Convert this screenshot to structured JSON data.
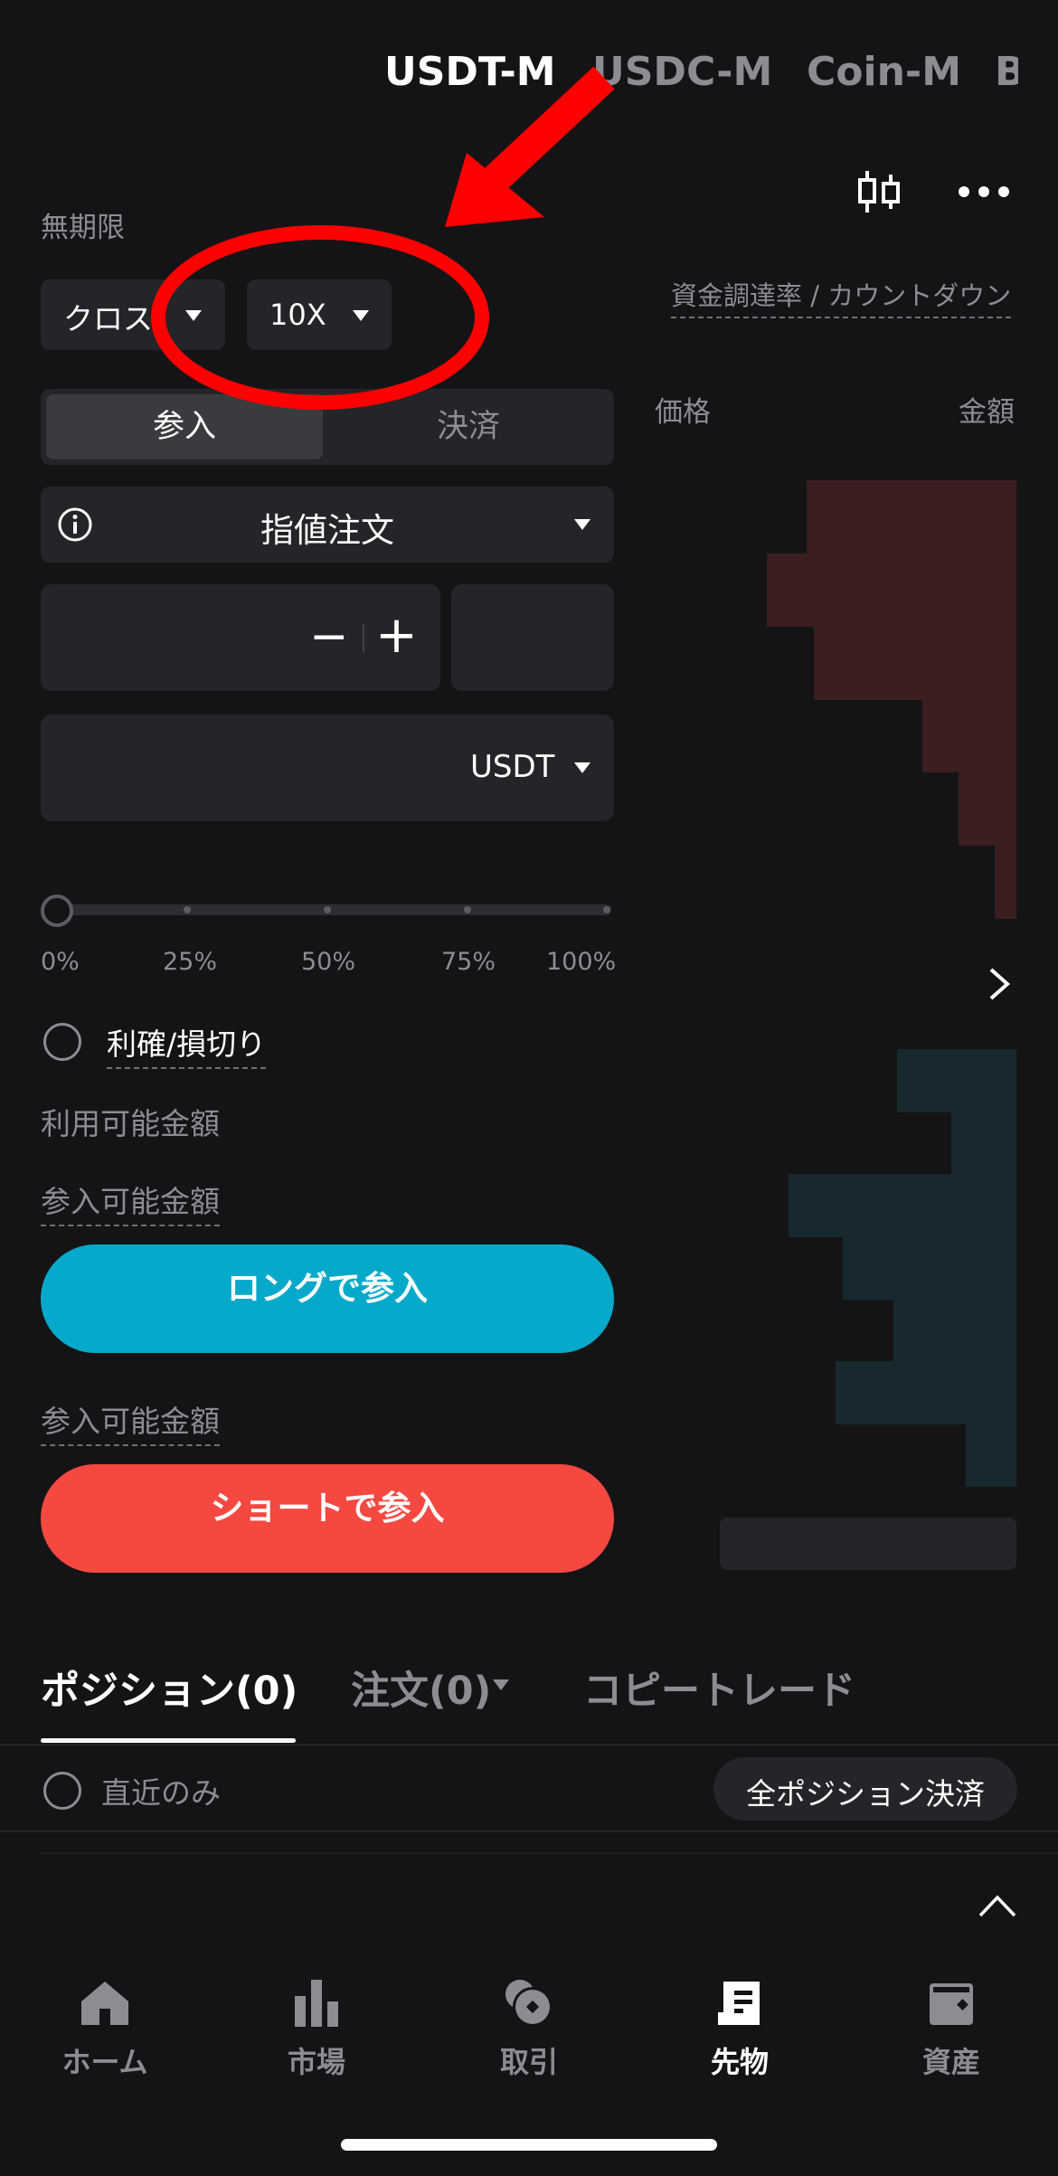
{
  "top_tabs": [
    "USDT-M",
    "USDC-M",
    "Coin-M",
    "B"
  ],
  "section_label": "無期限",
  "margin_mode": "クロス",
  "leverage": "10X",
  "funding_label": "資金調達率 / カウントダウン",
  "order_tabs": {
    "open": "参入",
    "close": "決済"
  },
  "order_type": "指値注文",
  "price_stepper": {
    "minus": "−",
    "plus": "+"
  },
  "amount_unit": "USDT",
  "slider": {
    "value": 0,
    "labels": [
      "0%",
      "25%",
      "50%",
      "75%",
      "100%"
    ]
  },
  "tp_sl_label": "利確/損切り",
  "available_label": "利用可能金額",
  "long_section": {
    "max_label": "参入可能金額",
    "button": "ロングで参入"
  },
  "short_section": {
    "max_label": "参入可能金額",
    "button": "ショートで参入"
  },
  "orderbook": {
    "price_header": "価格",
    "amount_header": "金額",
    "ask_color": "#3a1e20",
    "bid_color": "#17292f",
    "asks_depth": [
      0.58,
      0.58,
      0.69,
      0.69,
      0.56,
      0.56,
      0.26,
      0.26,
      0.16,
      0.16,
      0.06,
      0.06
    ],
    "bids_depth": [
      0.33,
      0.33,
      0.18,
      0.18,
      0.63,
      0.63,
      0.48,
      0.48,
      0.34,
      0.34,
      0.5,
      0.5,
      0.14,
      0.14
    ]
  },
  "bottom_tabs": {
    "positions": "ポジション(0)",
    "orders": "注文(0)",
    "copy": "コピートレード"
  },
  "recent_only": "直近のみ",
  "close_all": "全ポジション決済",
  "nav": [
    {
      "label": "ホーム",
      "icon": "home-icon"
    },
    {
      "label": "市場",
      "icon": "market-icon"
    },
    {
      "label": "取引",
      "icon": "trade-icon"
    },
    {
      "label": "先物",
      "icon": "futures-icon",
      "active": true
    },
    {
      "label": "資産",
      "icon": "wallet-icon"
    }
  ],
  "colors": {
    "accent_long": "#06a9c9",
    "accent_short": "#f44841",
    "annotation": "#ff0000",
    "background": "#141416"
  }
}
